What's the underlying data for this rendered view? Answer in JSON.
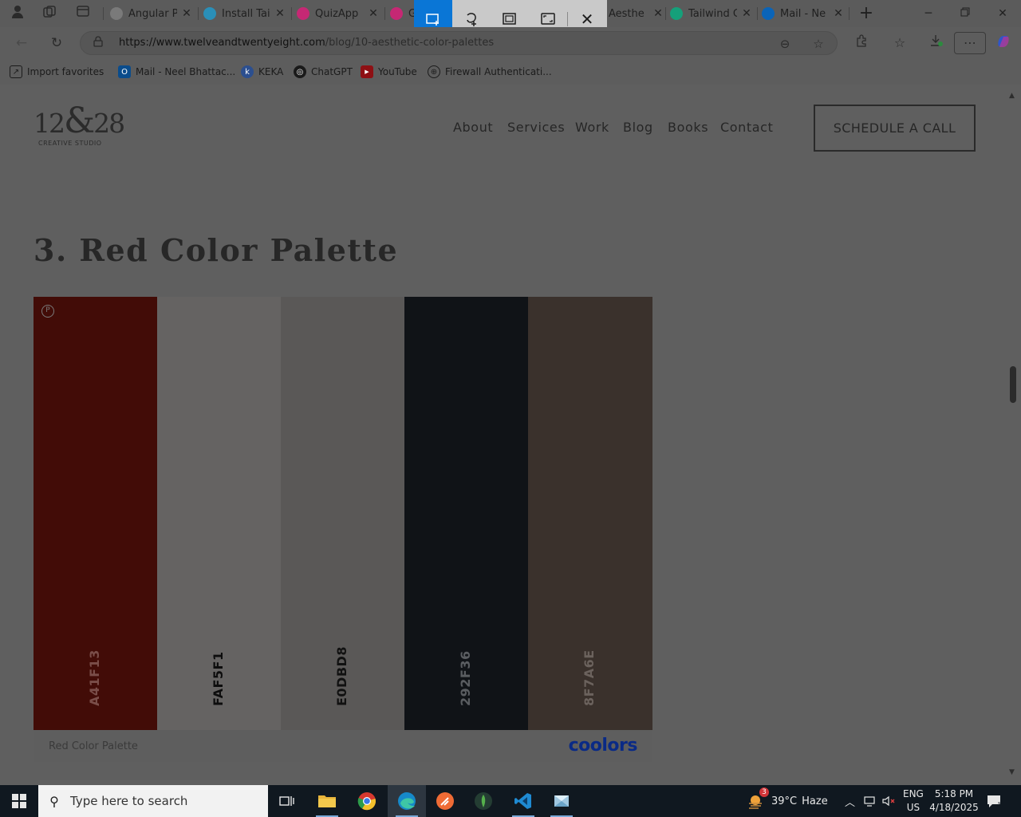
{
  "browser": {
    "tabs": [
      {
        "title": "Angular Pr",
        "favicon_color": "#7a7a7a"
      },
      {
        "title": "Install Tail",
        "favicon_color": "#2a8fb8"
      },
      {
        "title": "QuizApp",
        "favicon_color": "#c62874"
      },
      {
        "title": "G",
        "favicon_color": "#c62874"
      },
      {
        "title": "Aesthe",
        "favicon_color": "#2e2e2e"
      },
      {
        "title": "Tailwind C",
        "favicon_color": "#15a07a"
      },
      {
        "title": "Mail - Ne",
        "favicon_color": "#0a64b8"
      }
    ],
    "new_tab_label": "+",
    "address": {
      "url_host": "https://www.twelveandtwentyeight.com",
      "url_path": "/blog/10-aesthetic-color-palettes"
    },
    "favorites": [
      {
        "label": "Import favorites",
        "icon": "folder-import-icon"
      },
      {
        "label": "Mail - Neel Bhattac...",
        "icon": "outlook-icon",
        "color": "#0a64b8"
      },
      {
        "label": "KEKA",
        "icon": "keka-icon",
        "color": "#2c63c9"
      },
      {
        "label": "ChatGPT",
        "icon": "chatgpt-icon",
        "color": "#1a1a1a"
      },
      {
        "label": "YouTube",
        "icon": "youtube-icon",
        "color": "#c4161c"
      },
      {
        "label": "Firewall Authenticati...",
        "icon": "globe-icon"
      }
    ]
  },
  "snip_toolbar": {
    "tools": [
      "rectangle-snip-icon",
      "freeform-snip-icon",
      "window-snip-icon",
      "fullscreen-snip-icon",
      "close-icon"
    ]
  },
  "site": {
    "logo": {
      "mark_left": "12",
      "mark_amp": "&",
      "mark_right": "28",
      "sub": "CREATIVE STUDIO"
    },
    "nav": [
      "About",
      "Services",
      "Work",
      "Blog",
      "Books",
      "Contact"
    ],
    "cta": "SCHEDULE A CALL"
  },
  "content": {
    "heading": "3. Red Color Palette",
    "palette": {
      "name": "Red Color Palette",
      "brand": "coolors",
      "swatches": [
        {
          "hex": "A41F13",
          "color": "#420c07",
          "text_color": "#7a4e49"
        },
        {
          "hex": "FAF5F1",
          "color": "#656362",
          "text_color": "#0d0d0d"
        },
        {
          "hex": "E0DBD8",
          "color": "#5a5857",
          "text_color": "#111111"
        },
        {
          "hex": "292F36",
          "color": "#101317",
          "text_color": "#5a5d61"
        },
        {
          "hex": "8F7A6E",
          "color": "#3a312c",
          "text_color": "#6b625d"
        }
      ]
    }
  },
  "taskbar": {
    "search_placeholder": "Type here to search",
    "weather": {
      "temp": "39°C",
      "condition": "Haze",
      "badge": "3"
    },
    "lang": {
      "top": "ENG",
      "bottom": "US"
    },
    "clock": {
      "time": "5:18 PM",
      "date": "4/18/2025"
    },
    "notifications": "1"
  }
}
